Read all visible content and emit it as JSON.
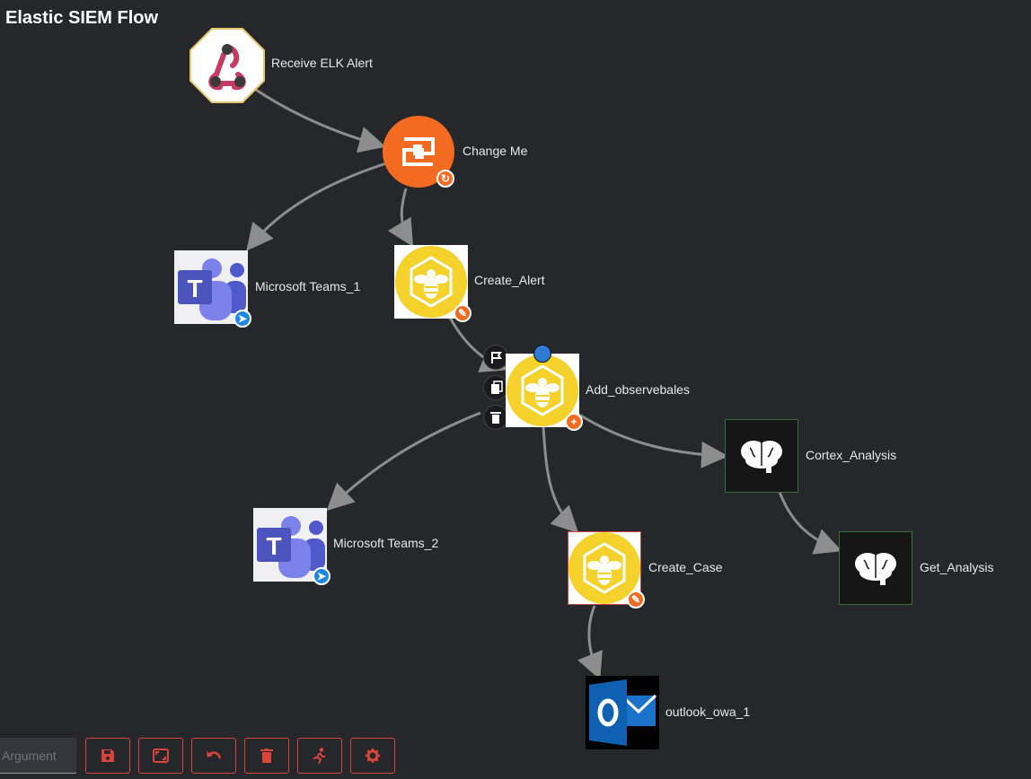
{
  "title": "Elastic SIEM Flow",
  "nodes": {
    "receive": {
      "label": "Receive ELK Alert",
      "icon": "webhook-icon"
    },
    "change": {
      "label": "Change Me",
      "icon": "shuffle-tools-icon"
    },
    "teams1": {
      "label": "Microsoft Teams_1",
      "icon": "microsoft-teams-icon"
    },
    "create_alert": {
      "label": "Create_Alert",
      "icon": "thehive-icon"
    },
    "add_obs": {
      "label": "Add_observebales",
      "icon": "thehive-icon"
    },
    "cortex": {
      "label": "Cortex_Analysis",
      "icon": "brain-icon"
    },
    "teams2": {
      "label": "Microsoft Teams_2",
      "icon": "microsoft-teams-icon"
    },
    "create_case": {
      "label": "Create_Case",
      "icon": "thehive-icon"
    },
    "get_analysis": {
      "label": "Get_Analysis",
      "icon": "brain-icon"
    },
    "outlook": {
      "label": "outlook_owa_1",
      "icon": "outlook-icon"
    }
  },
  "toolbar": {
    "argument_placeholder": "Argument",
    "buttons": [
      "save-icon",
      "fit-view-icon",
      "undo-icon",
      "delete-icon",
      "run-icon",
      "settings-icon"
    ]
  },
  "colors": {
    "accent": "#d9453a",
    "hive_yellow": "#f4d12b",
    "orange": "#f36b21",
    "teams_purple": "#5059c9"
  }
}
